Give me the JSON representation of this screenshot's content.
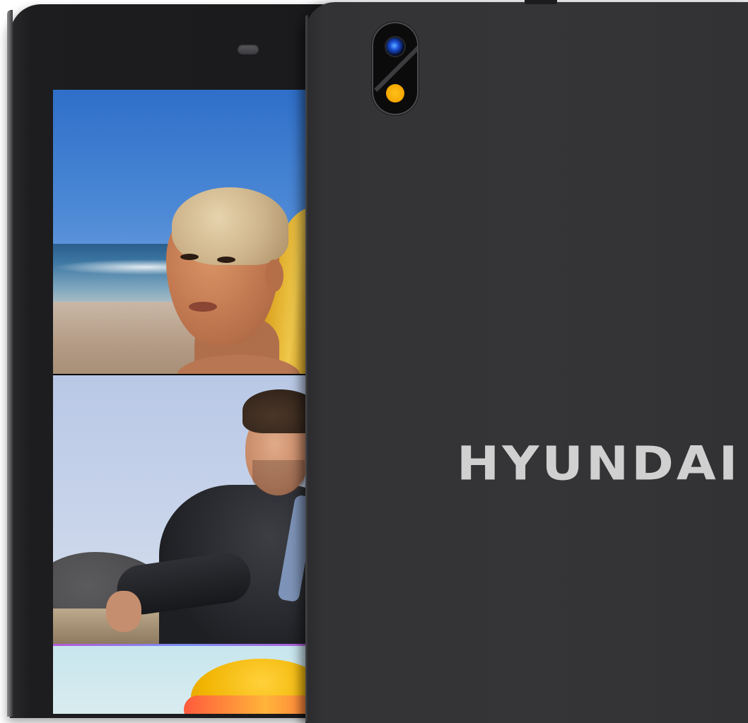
{
  "back_panel": {
    "brand": "HYUNDAI"
  },
  "colors": {
    "tablet_body": "#353537",
    "bezel": "#1a1a1c",
    "flash": "#f4a600",
    "logo": "#d0d0d0"
  },
  "icons": {
    "camera": "camera-lens-icon",
    "flash": "flash-icon"
  }
}
